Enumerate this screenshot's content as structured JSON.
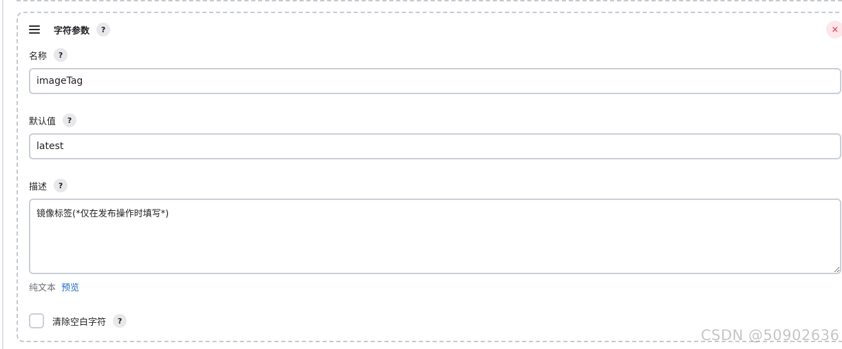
{
  "header": {
    "title": "字符参数",
    "help": "?",
    "close": "×"
  },
  "fields": {
    "name": {
      "label": "名称",
      "help": "?",
      "value": "imageTag"
    },
    "default_value": {
      "label": "默认值",
      "help": "?",
      "value": "latest"
    },
    "description": {
      "label": "描述",
      "help": "?",
      "value": "镜像标签(*仅在发布操作时填写*)"
    }
  },
  "format": {
    "plain_text": "纯文本",
    "preview": "预览"
  },
  "trim": {
    "label": "清除空白字符",
    "help": "?",
    "checked": false
  },
  "watermark": "CSDN @50902636",
  "colors": {
    "close": "#e6294b",
    "link": "#1b6ac9"
  }
}
